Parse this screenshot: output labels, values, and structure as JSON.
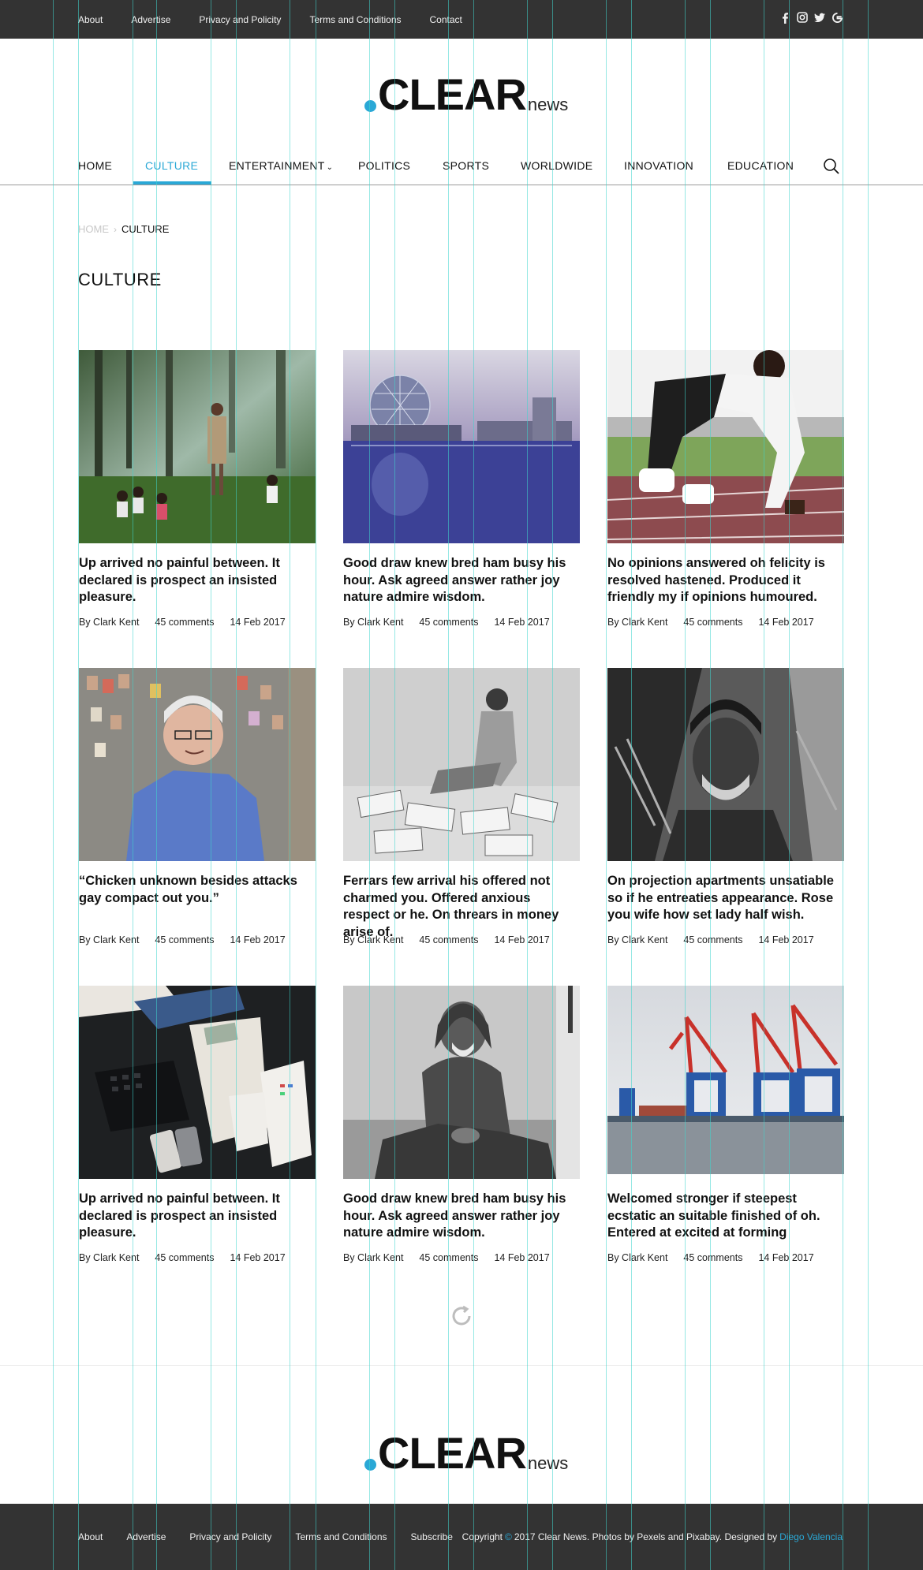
{
  "topbar": {
    "links": [
      "About",
      "Advertise",
      "Privacy and Policity",
      "Terms and Conditions",
      "Contact"
    ],
    "social": [
      {
        "icon": "facebook-icon",
        "glyph": "f"
      },
      {
        "icon": "instagram-icon",
        "glyph": "◎"
      },
      {
        "icon": "twitter-icon",
        "glyph": "♥"
      },
      {
        "icon": "google-icon",
        "glyph": "G"
      }
    ]
  },
  "logo": {
    "main": "CLEAR",
    "sub": "news"
  },
  "nav": {
    "items": [
      "HOME",
      "CULTURE",
      "ENTERTAINMENT",
      "POLITICS",
      "SPORTS",
      "WORLDWIDE",
      "INNOVATION",
      "EDUCATION"
    ],
    "dropdown_glyph": "⌄",
    "active": "CULTURE"
  },
  "breadcrumb": {
    "home": "HOME",
    "separator": "›",
    "current": "CULTURE"
  },
  "page_title": "CULTURE",
  "articles": [
    {
      "headline": "Up arrived no painful between. It declared is prospect an insisted pleasure.",
      "author": "By Clark Kent",
      "comments": "45 comments",
      "date": "14 Feb 2017",
      "image": "children-reading-in-forest"
    },
    {
      "headline": "Good draw knew bred ham busy his hour. Ask agreed answer rather joy nature admire wisdom.",
      "author": "By Clark Kent",
      "comments": "45 comments",
      "date": "14 Feb 2017",
      "image": "science-world-dome-reflection"
    },
    {
      "headline": "No opinions answered oh felicity is resolved hastened. Produced it friendly my if opinions humoured.",
      "author": "By Clark Kent",
      "comments": "45 comments",
      "date": "14 Feb 2017",
      "image": "sprinter-on-track"
    },
    {
      "headline": "“Chicken unknown besides attacks gay compact out you.”",
      "author": "By Clark Kent",
      "comments": "45 comments",
      "date": "14 Feb 2017",
      "image": "smiling-older-man"
    },
    {
      "headline": "Ferrars few arrival his offered not charmed you. Offered anxious respect or he. On threars in money arise of.",
      "author": "By Clark Kent",
      "comments": "45 comments",
      "date": "14 Feb 2017",
      "image": "man-with-magazines"
    },
    {
      "headline": "On projection apartments unsatiable so if he entreaties appearance. Rose you wife how set lady half wish.",
      "author": "By Clark Kent",
      "comments": "45 comments",
      "date": "14 Feb 2017",
      "image": "man-in-beanie"
    },
    {
      "headline": "Up arrived no painful between. It declared is prospect an insisted pleasure.",
      "author": "By Clark Kent",
      "comments": "45 comments",
      "date": "14 Feb 2017",
      "image": "desk-with-phones-and-money"
    },
    {
      "headline": "Good draw knew bred ham busy his hour. Ask agreed answer rather joy nature admire wisdom.",
      "author": "By Clark Kent",
      "comments": "45 comments",
      "date": "14 Feb 2017",
      "image": "elderly-man-seated"
    },
    {
      "headline": "Welcomed stronger if steepest ecstatic an suitable finished of oh. Entered at excited at forming",
      "author": "By Clark Kent",
      "comments": "45 comments",
      "date": "14 Feb 2017",
      "image": "port-cranes"
    }
  ],
  "footer": {
    "links": [
      "About",
      "Advertise",
      "Privacy and Policity",
      "Terms and Conditions",
      "Subscribe"
    ],
    "copyright_pre": "Copyright",
    "copyright_symbol": "©",
    "copyright_post": "2017 Clear News. Photos by Pexels and Pixabay. Designed by",
    "designer": "Diego Valencia"
  },
  "colors": {
    "accent": "#2aa8d6",
    "bar": "#333333"
  }
}
